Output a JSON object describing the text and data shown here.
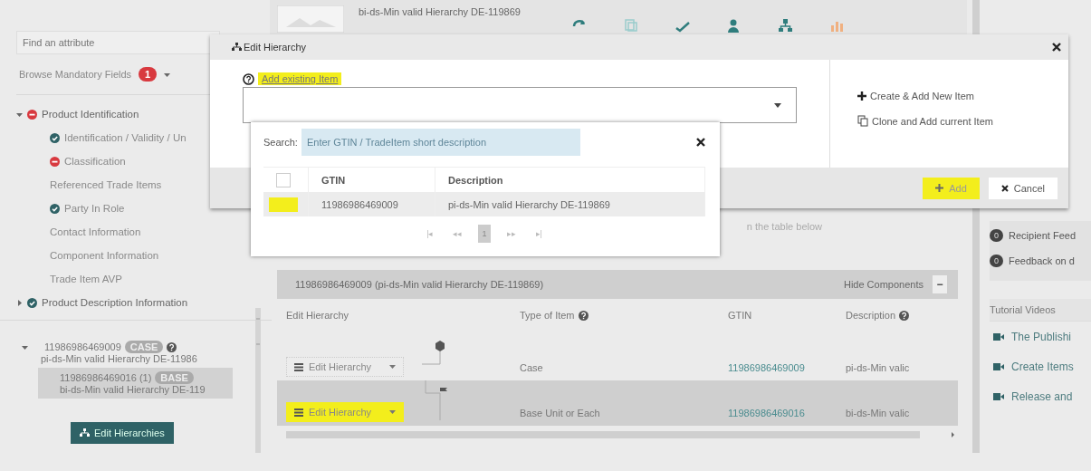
{
  "header": {
    "title": "bi-ds-Min valid Hierarchy DE-119869"
  },
  "sidebar": {
    "search": {
      "placeholder": "Find an attribute"
    },
    "mandatory": {
      "label": "Browse Mandatory Fields",
      "count": "1"
    },
    "tree": [
      {
        "label": "Product Identification",
        "kind": "error",
        "expanded": true,
        "children": [
          {
            "label": "Identification / Validity / Un",
            "kind": "ok"
          },
          {
            "label": "Classification",
            "kind": "error"
          },
          {
            "label": "Referenced Trade Items",
            "kind": "plain"
          },
          {
            "label": "Party In Role",
            "kind": "ok"
          },
          {
            "label": "Contact Information",
            "kind": "plain"
          },
          {
            "label": "Component Information",
            "kind": "plain"
          },
          {
            "label": "Trade Item AVP",
            "kind": "plain"
          }
        ]
      },
      {
        "label": "Product Description Information",
        "kind": "ok",
        "expanded": false
      }
    ],
    "hierarchy": [
      {
        "gtin": "11986986469009",
        "badge": "CASE",
        "description": "pi-ds-Min valid Hierarchy DE-11986",
        "expanded": true,
        "selected": false,
        "help": true,
        "children": [
          {
            "gtin": "11986986469016 (1)",
            "badge": "BASE",
            "description": "bi-ds-Min valid Hierarchy DE-119",
            "selected": true,
            "help": false
          }
        ]
      }
    ],
    "edit_button": "Edit Hierarchies"
  },
  "main": {
    "hint": "n the table below",
    "panel": {
      "title": "11986986469009 (pi-ds-Min valid Hierarchy DE-119869)",
      "toggle_label": "Hide Components",
      "toggle_symbol": "−"
    },
    "columns": [
      {
        "label": "Edit Hierarchy",
        "help": false
      },
      {
        "label": "Type of Item",
        "help": true
      },
      {
        "label": "GTIN",
        "help": false
      },
      {
        "label": "Description",
        "help": true
      }
    ],
    "rows": [
      {
        "kind": "case",
        "button": "Edit Hierarchy",
        "highlighted": false,
        "selected": false,
        "type": "Case",
        "gtin": "11986986469009",
        "description": "pi-ds-Min valic"
      },
      {
        "kind": "base",
        "button": "Edit Hierarchy",
        "highlighted": true,
        "selected": true,
        "type": "Base Unit or Each",
        "gtin": "11986986469016",
        "description": "bi-ds-Min valic"
      }
    ]
  },
  "right_panel": {
    "feedback": [
      {
        "count": "0",
        "label": "Recipient Feed"
      },
      {
        "count": "0",
        "label": "Feedback on d"
      }
    ],
    "videos_title": "Tutorial Videos",
    "videos": [
      "The Publishi",
      "Create Items",
      "Release and"
    ]
  },
  "dialog": {
    "title": "Edit Hierarchy",
    "add_existing": {
      "label": "Add existing Item",
      "highlighted": true
    },
    "actions": [
      {
        "kind": "create",
        "label": "Create & Add New Item"
      },
      {
        "kind": "clone",
        "label": "Clone and Add current Item"
      }
    ],
    "buttons": [
      {
        "kind": "add",
        "label": "Add",
        "highlighted": true
      },
      {
        "kind": "cancel",
        "label": "Cancel",
        "highlighted": false
      }
    ]
  },
  "search_popup": {
    "label": "Search:",
    "placeholder": "Enter GTIN / TradeItem short description",
    "columns": [
      "GTIN",
      "Description"
    ],
    "header_checked": false,
    "rows": [
      {
        "checked": false,
        "highlighted": true,
        "gtin": "11986986469009",
        "description": "pi-ds-Min valid Hierarchy DE-119869"
      }
    ],
    "pages": [
      {
        "label": "|◂",
        "selected": false
      },
      {
        "label": "◂◂",
        "selected": false
      },
      {
        "label": "1",
        "selected": true
      },
      {
        "label": "▸▸",
        "selected": false
      },
      {
        "label": "▸|",
        "selected": false
      }
    ]
  }
}
